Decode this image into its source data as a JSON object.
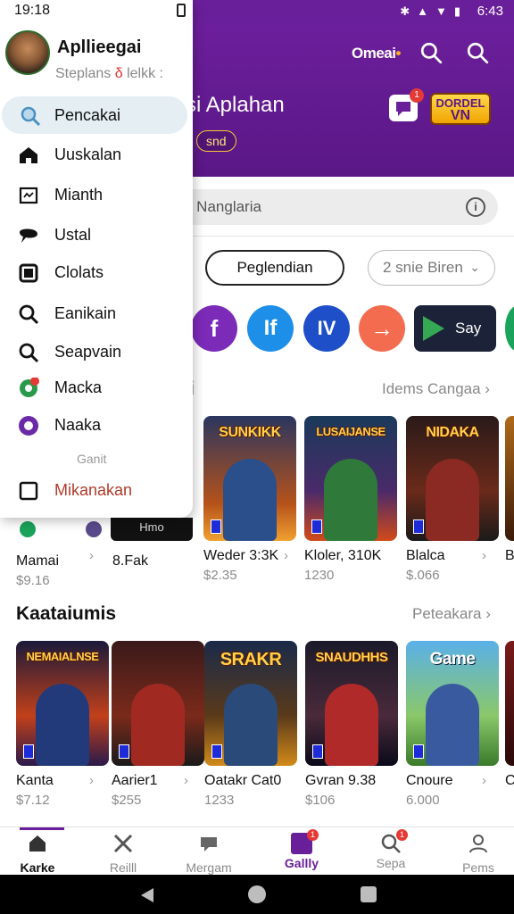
{
  "status_bar": {
    "time_left": "19:18",
    "time_right": "6:43"
  },
  "header": {
    "brand": "Omeai",
    "title": "si Aplahan",
    "chip": "snd",
    "message_badge": "1",
    "logo_line1": "DORDEL",
    "logo_line2": "VN"
  },
  "search": {
    "placeholder": "g Nanglaria",
    "info_glyph": "i"
  },
  "filters": {
    "active": "Peglendian",
    "select": "2 snie Biren"
  },
  "apps": [
    {
      "icon": "facebook-icon",
      "glyph": "f",
      "color": "#7b2bb8"
    },
    {
      "icon": "facebook-alt-icon",
      "glyph": "If",
      "color": "#1e8fe8"
    },
    {
      "icon": "iv-icon",
      "glyph": "IV",
      "color": "#1e4fc8"
    },
    {
      "icon": "share-arrow-icon",
      "glyph": "→",
      "color": "#f36c4f"
    }
  ],
  "play_store": {
    "label": "Say"
  },
  "section1": {
    "title": "i",
    "link": "Idems Cangaa"
  },
  "section1_partial": [
    {
      "name": "Mamai",
      "price": "$9.16"
    },
    {
      "name": "8.Fak",
      "price": ""
    }
  ],
  "behind_strip": "Hmo",
  "row1": [
    {
      "art_title": "SUNKIKK",
      "name": "Weder 3:3K",
      "price": "$2.35"
    },
    {
      "art_title": "LUSAIJANSE",
      "name": "Kloler, 310K",
      "price": "1230"
    },
    {
      "art_title": "NIDAKA",
      "name": "Blalca",
      "price": "$.066"
    }
  ],
  "row1_edge": "B",
  "section2": {
    "title": "Kaataiumis",
    "link": "Peteakara"
  },
  "row2": [
    {
      "art_title": "NEMAIALNSE",
      "name": "Kanta",
      "price": "$7.12"
    },
    {
      "art_title": "",
      "name": "Aarier1",
      "price": "$255"
    },
    {
      "art_title": "SRAKR",
      "name": "Oatakr Cat0",
      "price": "1233"
    },
    {
      "art_title": "SNAUDHHS",
      "name": "Gvran 9.38",
      "price": "$106"
    },
    {
      "art_title": "Game",
      "name": "Cnoure",
      "price": "6.000"
    }
  ],
  "row2_edge": "C",
  "bottom_nav": [
    {
      "label": "Karke"
    },
    {
      "label": "Reilll"
    },
    {
      "label": "Mergam"
    },
    {
      "label": "Gallly",
      "badge": "1"
    },
    {
      "label": "Sepa",
      "badge": "1"
    },
    {
      "label": "Pems"
    }
  ],
  "drawer": {
    "time": "19:18",
    "name": "Apllieegai",
    "subtitle": "Steplans ",
    "subtitle_mark": "δ",
    "subtitle_tail": " lelkk  :",
    "items": [
      {
        "label": "Pencakai",
        "icon": "search-icon"
      },
      {
        "label": "Uuskalan",
        "icon": "home-icon"
      },
      {
        "label": "Mianth",
        "icon": "image-icon"
      },
      {
        "label": "Ustal",
        "icon": "chat-bubble-icon"
      },
      {
        "label": "Clolats",
        "icon": "square-icon"
      },
      {
        "label": "Eanikain",
        "icon": "search-icon"
      },
      {
        "label": "Seapvain",
        "icon": "search-icon"
      },
      {
        "label": "Macka",
        "icon": "shield-icon",
        "badge": "!"
      },
      {
        "label": "Naaka",
        "icon": "circle-icon"
      }
    ],
    "section_label": "Ganit",
    "footer_item": {
      "label": "Mikanakan",
      "icon": "checkbox-icon"
    }
  }
}
